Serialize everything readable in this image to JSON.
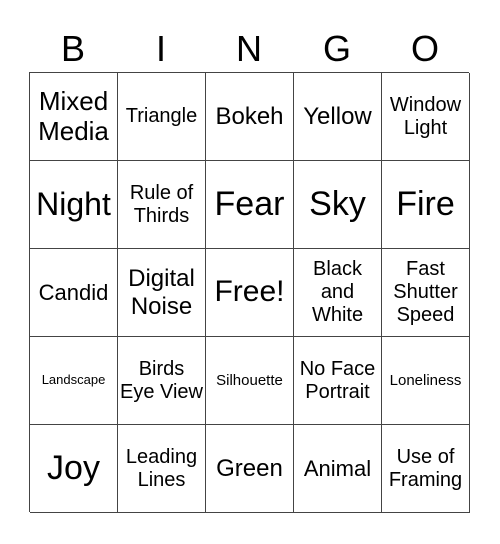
{
  "header": [
    "B",
    "I",
    "N",
    "G",
    "O"
  ],
  "cells": [
    [
      "Mixed Media",
      "Triangle",
      "Bokeh",
      "Yellow",
      "Window Light"
    ],
    [
      "Night",
      "Rule of Thirds",
      "Fear",
      "Sky",
      "Fire"
    ],
    [
      "Candid",
      "Digital Noise",
      "Free!",
      "Black and White",
      "Fast Shutter Speed"
    ],
    [
      "Landscape",
      "Birds Eye View",
      "Silhouette",
      "No Face Portrait",
      "Loneliness"
    ],
    [
      "Joy",
      "Leading Lines",
      "Green",
      "Animal",
      "Use of Framing"
    ]
  ]
}
